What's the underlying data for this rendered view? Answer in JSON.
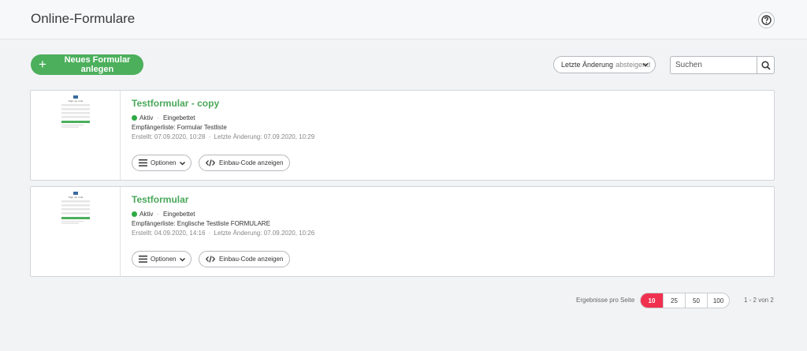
{
  "header": {
    "title": "Online-Formulare",
    "help_icon": "help-icon"
  },
  "toolbar": {
    "new_button_label": "Neues Formular anlegen",
    "sort_label": "Letzte Änderung",
    "sort_direction": "absteigend",
    "search_placeholder": "Suchen"
  },
  "forms": [
    {
      "title": "Testformular - copy",
      "status": "Aktiv",
      "mode": "Eingebettet",
      "recipient": "Empfängerliste: Formular Testliste",
      "created": "Erstellt: 07.09.2020, 10:28",
      "modified": "Letzte Änderung: 07.09.2020, 10:29",
      "options_label": "Optionen",
      "code_label": "Einbau-Code anzeigen",
      "thumb_heading": "Sign up now"
    },
    {
      "title": "Testformular",
      "status": "Aktiv",
      "mode": "Eingebettet",
      "recipient": "Empfängerliste: Englische Testliste FORMULARE",
      "created": "Erstellt: 04.09.2020, 14:16",
      "modified": "Letzte Änderung: 07.09.2020, 10:26",
      "options_label": "Optionen",
      "code_label": "Einbau-Code anzeigen",
      "thumb_heading": "Sign up now"
    }
  ],
  "pagination": {
    "label": "Ergebnisse pro Seite",
    "options": [
      "10",
      "25",
      "50",
      "100"
    ],
    "active": "10",
    "range": "1 - 2 von 2"
  },
  "colors": {
    "accent_green": "#4caf5c",
    "active_page": "#f0304f",
    "status_dot": "#2eaa45"
  }
}
